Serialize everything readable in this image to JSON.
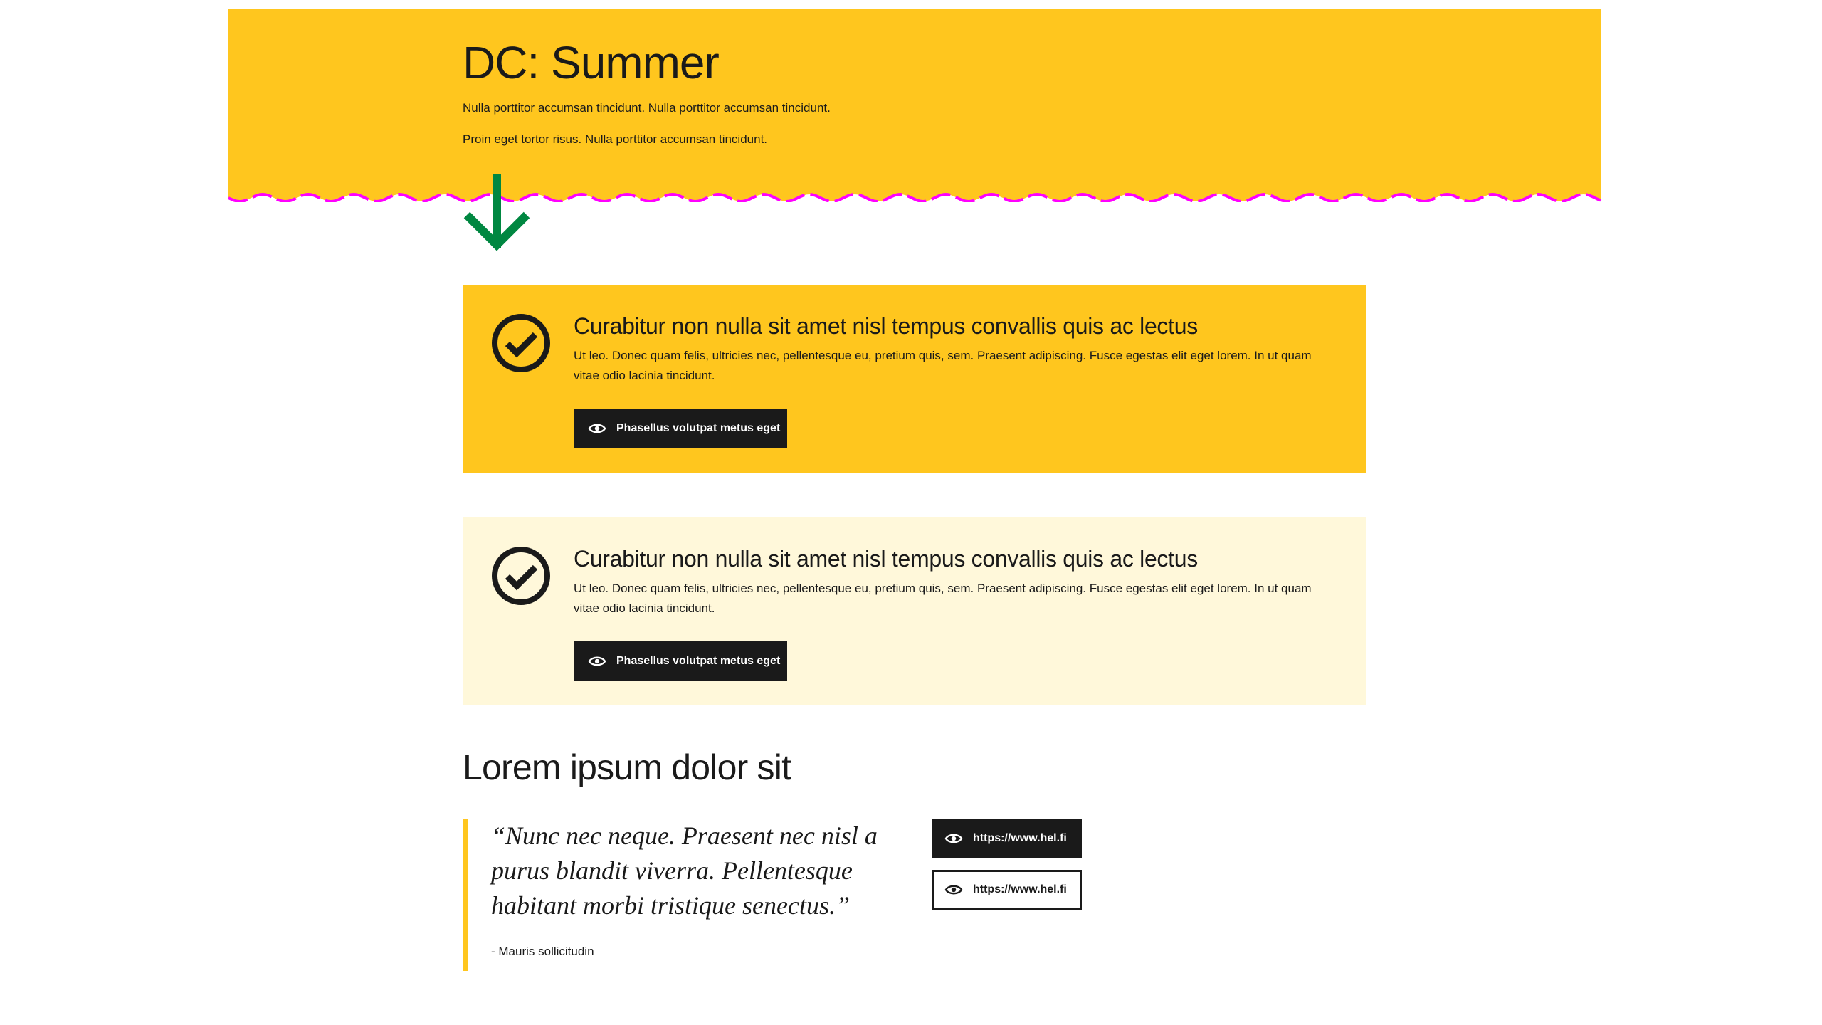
{
  "colors": {
    "summer": "#ffc61e",
    "summer_light": "#fff8da",
    "wave_accent": "#ff00ff",
    "arrow": "#008741",
    "dark": "#1a1a1a"
  },
  "hero": {
    "title": "DC: Summer",
    "paragraphs": [
      "Nulla porttitor accumsan tincidunt. Nulla porttitor accumsan tincidunt.",
      "Proin eget tortor risus. Nulla porttitor accumsan tincidunt."
    ],
    "arrow_icon": "arrow-down-icon"
  },
  "notifications": [
    {
      "icon": "check-circle-icon",
      "title": "Curabitur non nulla sit amet nisl tempus convallis quis ac lectus",
      "text": "Ut leo. Donec quam felis, ultricies nec, pellentesque eu, pretium quis, sem. Praesent adipiscing. Fusce egestas elit eget lorem. In ut quam vitae odio lacinia tincidunt.",
      "button_label": "Phasellus volutpat metus eget",
      "button_icon": "eye-icon"
    },
    {
      "icon": "check-circle-icon",
      "title": "Curabitur non nulla sit amet nisl tempus convallis quis ac lectus",
      "text": "Ut leo. Donec quam felis, ultricies nec, pellentesque eu, pretium quis, sem. Praesent adipiscing. Fusce egestas elit eget lorem. In ut quam vitae odio lacinia tincidunt.",
      "button_label": "Phasellus volutpat metus eget",
      "button_icon": "eye-icon"
    }
  ],
  "section": {
    "title": "Lorem ipsum dolor sit",
    "quote": {
      "text": "“Nunc nec neque. Praesent nec nisl a purus blandit viverra. Pellentesque habitant morbi tristique senectus.”",
      "author": "- Mauris sollicitudin"
    },
    "links": [
      {
        "label": "https://www.hel.fi",
        "icon": "eye-icon"
      },
      {
        "label": "https://www.hel.fi",
        "icon": "eye-icon"
      }
    ]
  }
}
